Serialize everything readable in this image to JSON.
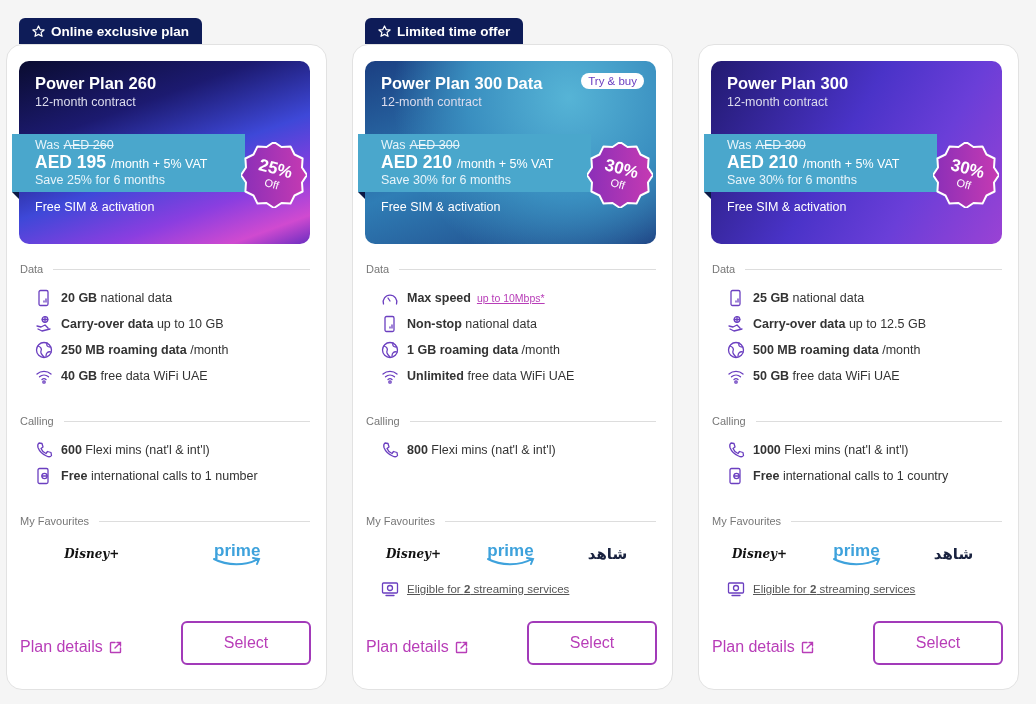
{
  "plans": [
    {
      "ribbon": {
        "label": "Online exclusive plan"
      },
      "hero": {
        "kind": "waves",
        "title": "Power Plan 260",
        "contract": "12-month contract",
        "was_label": "Was",
        "was_price": "AED 260",
        "price": "AED 195",
        "price_suffix": "/month + 5% VAT",
        "saving": "Save 25% for 6 months",
        "badge": {
          "percent": "25%",
          "label": "Off"
        },
        "extra": "Free SIM & activation"
      },
      "sections": [
        {
          "title": "Data",
          "items": [
            {
              "kind": "phone-data",
              "text": "**20 GB** national data"
            },
            {
              "kind": "carry-over",
              "text": "**Carry-over data** up to 10 GB"
            },
            {
              "kind": "globe",
              "text": "**250 MB roaming data** /month"
            },
            {
              "kind": "wifi",
              "text": "**40 GB** free data WiFi UAE"
            }
          ]
        },
        {
          "title": "Calling",
          "items": [
            {
              "kind": "call",
              "text": "**600** Flexi mins (nat'l & int'l)"
            },
            {
              "kind": "intl-call",
              "text": "**Free** international calls to 1 number"
            }
          ]
        }
      ],
      "favourites": {
        "title": "My Favourites",
        "logos": [
          {
            "kind": "disney",
            "text": "Disney+"
          },
          {
            "kind": "prime",
            "text": "prime"
          }
        ]
      },
      "details_link": "Plan details",
      "select_button": "Select"
    },
    {
      "ribbon": {
        "label": "Limited time offer"
      },
      "hero": {
        "kind": "blue",
        "title": "Power Plan 300 Data",
        "tag": "Try & buy",
        "contract": "12-month contract",
        "was_label": "Was",
        "was_price": "AED 300",
        "price": "AED 210",
        "price_suffix": "/month + 5% VAT",
        "saving": "Save 30% for 6 months",
        "badge": {
          "percent": "30%",
          "label": "Off"
        },
        "extra": "Free SIM & activation"
      },
      "sections": [
        {
          "title": "Data",
          "items": [
            {
              "kind": "speed",
              "text": "**Max speed**",
              "link": "up to 10Mbps*"
            },
            {
              "kind": "phone-data",
              "text": "**Non-stop** national data"
            },
            {
              "kind": "globe",
              "text": "**1 GB roaming data** /month"
            },
            {
              "kind": "wifi",
              "text": "**Unlimited** free data WiFi UAE"
            }
          ]
        },
        {
          "title": "Calling",
          "items": [
            {
              "kind": "call",
              "text": "**800** Flexi mins (nat'l & int'l)"
            }
          ]
        }
      ],
      "favourites": {
        "title": "My Favourites",
        "logos": [
          {
            "kind": "disney",
            "text": "Disney+"
          },
          {
            "kind": "prime",
            "text": "prime"
          },
          {
            "kind": "shahid",
            "text": "شاهد"
          }
        ],
        "eligible": "Eligible for **2** streaming services"
      },
      "details_link": "Plan details",
      "select_button": "Select"
    },
    {
      "hero": {
        "kind": "purple",
        "title": "Power Plan 300",
        "contract": "12-month contract",
        "was_label": "Was",
        "was_price": "AED 300",
        "price": "AED 210",
        "price_suffix": "/month + 5% VAT",
        "saving": "Save 30% for 6 months",
        "badge": {
          "percent": "30%",
          "label": "Off"
        },
        "extra": "Free SIM & activation"
      },
      "sections": [
        {
          "title": "Data",
          "items": [
            {
              "kind": "phone-data",
              "text": "**25 GB** national data"
            },
            {
              "kind": "carry-over",
              "text": "**Carry-over data** up to 12.5 GB"
            },
            {
              "kind": "globe",
              "text": "**500 MB roaming data** /month"
            },
            {
              "kind": "wifi",
              "text": "**50 GB** free data WiFi UAE"
            }
          ]
        },
        {
          "title": "Calling",
          "items": [
            {
              "kind": "call",
              "text": "**1000** Flexi mins (nat'l & int'l)"
            },
            {
              "kind": "intl-call",
              "text": "**Free** international calls to 1 country"
            }
          ]
        }
      ],
      "favourites": {
        "title": "My Favourites",
        "logos": [
          {
            "kind": "disney",
            "text": "Disney+"
          },
          {
            "kind": "prime",
            "text": "prime"
          },
          {
            "kind": "shahid",
            "text": "شاهد"
          }
        ],
        "eligible": "Eligible for **2** streaming services"
      },
      "details_link": "Plan details",
      "select_button": "Select"
    }
  ]
}
